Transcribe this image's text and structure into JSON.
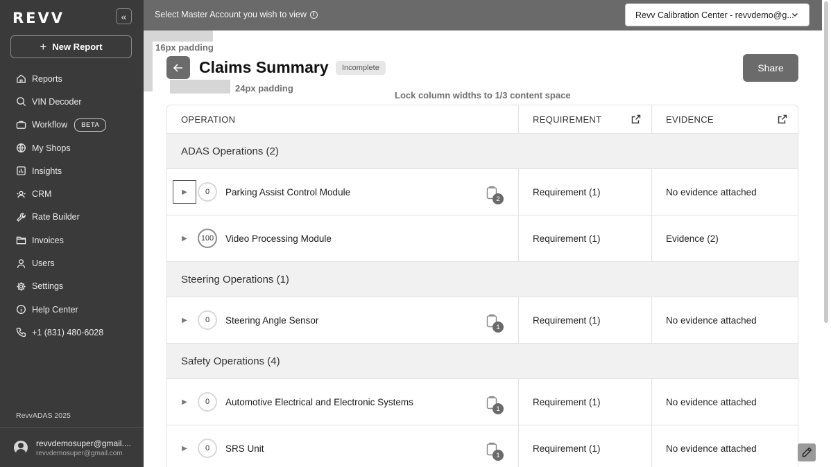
{
  "sidebar": {
    "logo": "REVV",
    "new_report_label": "New Report",
    "items": [
      {
        "label": "Reports",
        "icon": "home-icon"
      },
      {
        "label": "VIN Decoder",
        "icon": "search-icon"
      },
      {
        "label": "Workflow",
        "icon": "workflow-icon",
        "badge": "BETA"
      },
      {
        "label": "My Shops",
        "icon": "globe-icon"
      },
      {
        "label": "Insights",
        "icon": "chart-icon"
      },
      {
        "label": "CRM",
        "icon": "crm-icon"
      },
      {
        "label": "Rate Builder",
        "icon": "wrench-icon"
      },
      {
        "label": "Invoices",
        "icon": "folder-icon"
      },
      {
        "label": "Users",
        "icon": "user-icon"
      },
      {
        "label": "Settings",
        "icon": "gear-icon"
      },
      {
        "label": "Help Center",
        "icon": "info-icon"
      },
      {
        "label": "+1 (831) 480-6028",
        "icon": "phone-icon"
      }
    ],
    "version": "RevvADAS 2025",
    "user": {
      "name": "revvdemosuper@gmail....",
      "email": "revvdemosuper@gmail.com"
    }
  },
  "topbar": {
    "label": "Select Master Account you wish to view",
    "account_value": "Revv Calibration Center - revvdemo@g..."
  },
  "overlays": {
    "padding_16": "16px padding",
    "padding_24": "24px padding",
    "lock_note": "Lock column widths to 1/3 content space"
  },
  "header": {
    "title": "Claims Summary",
    "status": "Incomplete",
    "share_label": "Share"
  },
  "table": {
    "columns": [
      "OPERATION",
      "REQUIREMENT",
      "EVIDENCE"
    ],
    "groups": [
      {
        "label": "ADAS Operations (2)",
        "rows": [
          {
            "score": "0",
            "name": "Parking Assist Control Module",
            "attachments": "2",
            "requirement": "Requirement (1)",
            "evidence": "No evidence attached"
          },
          {
            "score": "100",
            "name": "Video Processing Module",
            "attachments": null,
            "requirement": "Requirement (1)",
            "evidence": "Evidence (2)"
          }
        ]
      },
      {
        "label": "Steering Operations (1)",
        "rows": [
          {
            "score": "0",
            "name": "Steering Angle Sensor",
            "attachments": "1",
            "requirement": "Requirement (1)",
            "evidence": "No evidence attached"
          }
        ]
      },
      {
        "label": "Safety Operations (4)",
        "rows": [
          {
            "score": "0",
            "name": "Automotive Electrical and Electronic Systems",
            "attachments": "1",
            "requirement": "Requirement (1)",
            "evidence": "No evidence attached"
          },
          {
            "score": "0",
            "name": "SRS Unit",
            "attachments": "1",
            "requirement": "Requirement (1)",
            "evidence": "No evidence attached"
          }
        ]
      }
    ]
  }
}
